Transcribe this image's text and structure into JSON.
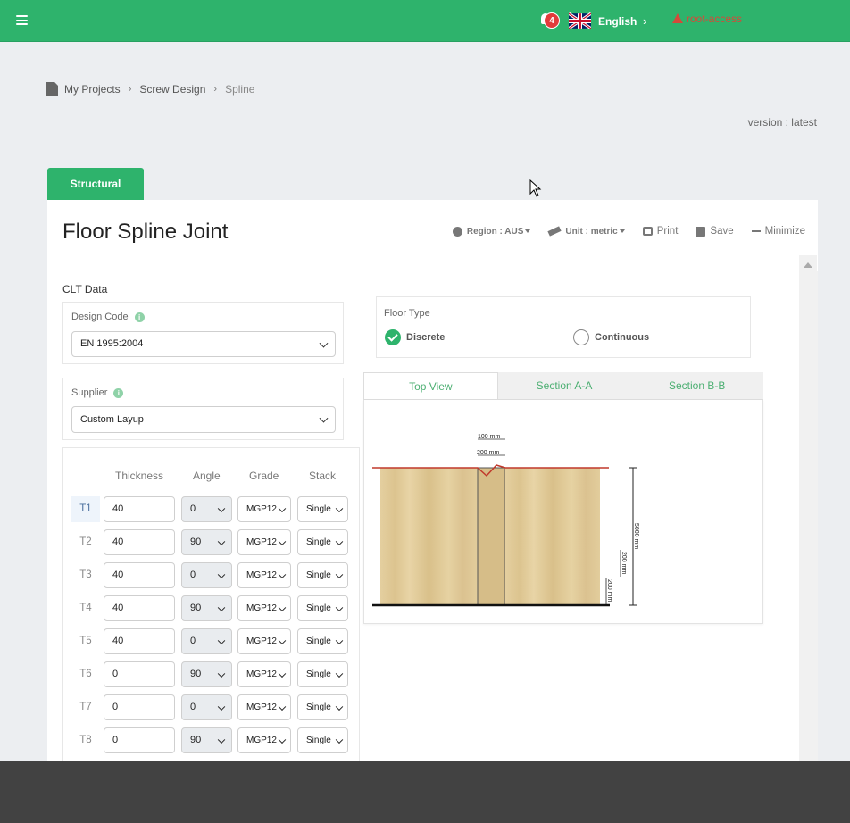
{
  "header": {
    "notification_count": "4",
    "language": "English",
    "user": "root-access"
  },
  "breadcrumb": {
    "items": [
      "My Projects",
      "Screw Design",
      "Spline"
    ]
  },
  "version_text": "version : latest",
  "tabs": {
    "structural": "Structural"
  },
  "page": {
    "title": "Floor Spline Joint",
    "region_label": "Region : AUS",
    "unit_label": "Unit : metric",
    "print_label": "Print",
    "save_label": "Save",
    "minimize_label": "Minimize"
  },
  "clt": {
    "section_label": "CLT Data",
    "design_code_label": "Design Code",
    "design_code_value": "EN 1995:2004",
    "supplier_label": "Supplier",
    "supplier_value": "Custom Layup",
    "columns": [
      "Thickness",
      "Angle",
      "Grade",
      "Stack"
    ],
    "layers": [
      {
        "name": "T1",
        "thickness": "40",
        "angle": "0",
        "grade": "MGP12",
        "stack": "Single"
      },
      {
        "name": "T2",
        "thickness": "40",
        "angle": "90",
        "grade": "MGP12",
        "stack": "Single"
      },
      {
        "name": "T3",
        "thickness": "40",
        "angle": "0",
        "grade": "MGP12",
        "stack": "Single"
      },
      {
        "name": "T4",
        "thickness": "40",
        "angle": "90",
        "grade": "MGP12",
        "stack": "Single"
      },
      {
        "name": "T5",
        "thickness": "40",
        "angle": "0",
        "grade": "MGP12",
        "stack": "Single"
      },
      {
        "name": "T6",
        "thickness": "0",
        "angle": "90",
        "grade": "MGP12",
        "stack": "Single"
      },
      {
        "name": "T7",
        "thickness": "0",
        "angle": "0",
        "grade": "MGP12",
        "stack": "Single"
      },
      {
        "name": "T8",
        "thickness": "0",
        "angle": "90",
        "grade": "MGP12",
        "stack": "Single"
      }
    ]
  },
  "floor_type": {
    "label": "Floor Type",
    "options": [
      "Discrete",
      "Continuous"
    ],
    "selected": "Discrete"
  },
  "view_tabs": [
    "Top View",
    "Section A-A",
    "Section B-B"
  ],
  "drawing": {
    "dim_top_small": "100 mm",
    "dim_top_large": "200 mm",
    "dim_height": "5000 mm",
    "dim_mid": "200 mm",
    "dim_low": "200 mm"
  },
  "colors": {
    "brand": "#2eb36c",
    "alert": "#d44a3a"
  }
}
